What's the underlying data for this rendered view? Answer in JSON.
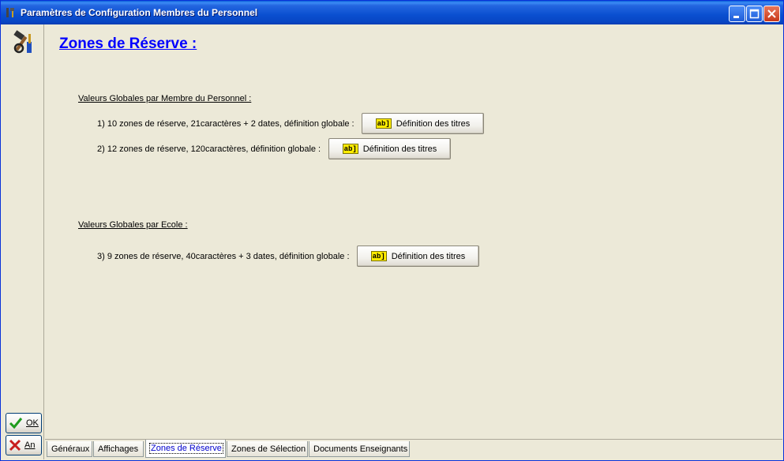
{
  "window": {
    "title": "Paramètres de Configuration Membres du Personnel"
  },
  "sidebar": {
    "ok_label": "OK",
    "cancel_label": "An"
  },
  "main": {
    "title": "Zones de Réserve :",
    "group1": {
      "label": "Valeurs Globales par Membre du Personnel :",
      "rows": [
        {
          "text": "1) 10 zones de réserve, 21caractères + 2 dates, définition globale :",
          "button": "Définition des titres"
        },
        {
          "text": "2) 12 zones de réserve, 120caractères, définition globale :",
          "button": "Définition des titres"
        }
      ]
    },
    "group2": {
      "label": "Valeurs Globales par Ecole :",
      "rows": [
        {
          "text": "3) 9 zones de réserve, 40caractères + 3 dates, définition globale :",
          "button": "Définition des titres"
        }
      ]
    },
    "button_icon_text": "ab]"
  },
  "tabs": [
    {
      "label": "Généraux"
    },
    {
      "label": "Affichages"
    },
    {
      "label": "Zones de Réserve",
      "active": true
    },
    {
      "label": "Zones de Sélection"
    },
    {
      "label": "Documents Enseignants"
    }
  ],
  "colors": {
    "title_link": "#0000FF",
    "titlebar": "#0A4FD0",
    "background": "#ECE9D8"
  }
}
